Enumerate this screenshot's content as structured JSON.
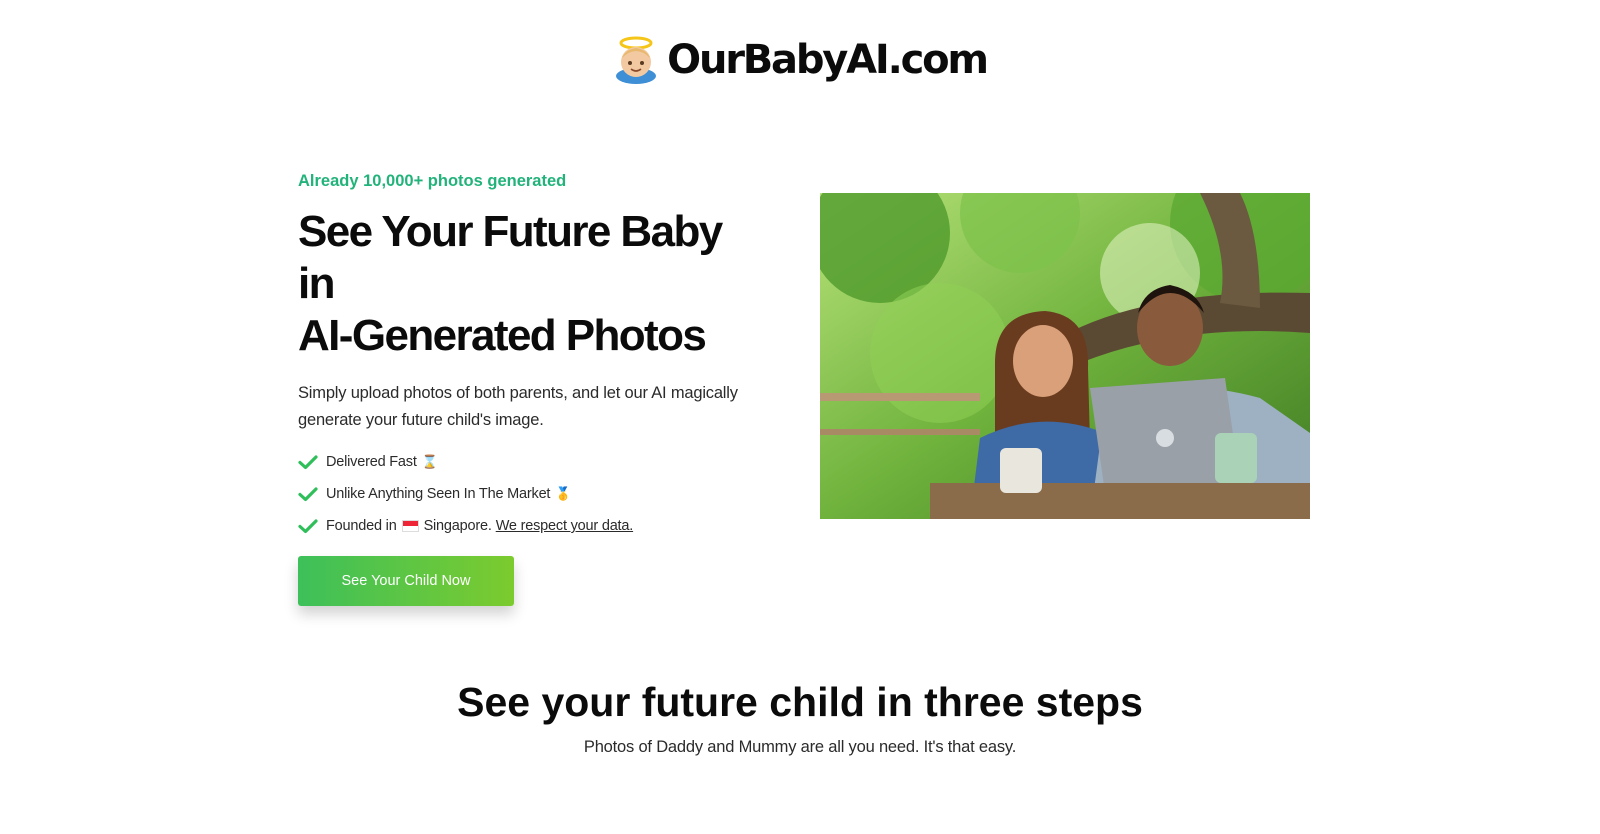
{
  "brand": {
    "name": "OurBabyAI.com",
    "logo_icon": "baby-angel-icon"
  },
  "hero": {
    "tagline": "Already 10,000+ photos generated",
    "title_line1": "See Your Future Baby in",
    "title_line2": "AI-Generated Photos",
    "subtitle": "Simply upload photos of both parents, and let our AI magically generate your future child's image.",
    "features": [
      {
        "text": "Delivered Fast",
        "emoji": "⌛"
      },
      {
        "text": "Unlike Anything Seen In The Market",
        "emoji": "🥇"
      },
      {
        "text_before": "Founded in",
        "flag": "singapore-flag-icon",
        "text_after": "Singapore.",
        "link": "We respect your data."
      }
    ],
    "cta_label": "See Your Child Now",
    "photo_alt": "couple-with-laptop-photo"
  },
  "steps": {
    "title": "See your future child in three steps",
    "subtitle": "Photos of Daddy and Mummy are all you need. It's that easy."
  },
  "colors": {
    "accent_green": "#22b37a",
    "check_green": "#2fbf5a",
    "button_gradient_start": "#3dc05a",
    "button_gradient_end": "#7ccb2e"
  }
}
